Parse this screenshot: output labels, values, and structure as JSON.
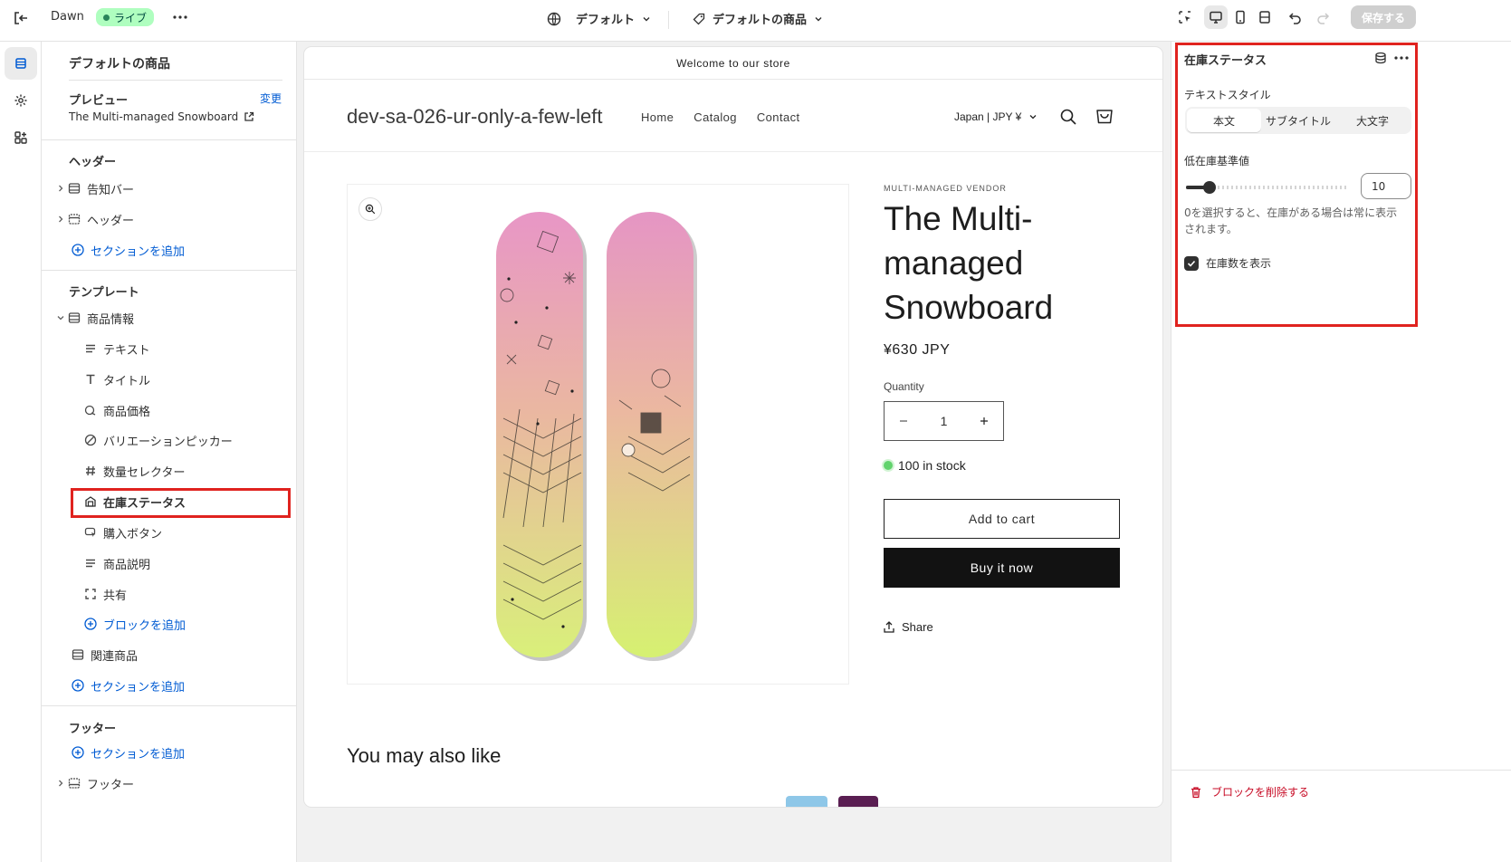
{
  "topbar": {
    "theme_name": "Dawn",
    "live_badge": "ライブ",
    "template_select": "デフォルト",
    "page_select": "デフォルトの商品",
    "save_label": "保存する"
  },
  "left_panel": {
    "title": "デフォルトの商品",
    "preview_label": "プレビュー",
    "preview_change": "変更",
    "preview_product": "The Multi-managed Snowboard",
    "header_section": {
      "heading": "ヘッダー",
      "items": [
        {
          "label": "告知バー",
          "icon": "announcement-bar-icon"
        },
        {
          "label": "ヘッダー",
          "icon": "header-layout-icon"
        }
      ],
      "add_section": "セクションを追加"
    },
    "template_section": {
      "heading": "テンプレート",
      "product_info": "商品情報",
      "blocks": [
        {
          "label": "テキスト",
          "icon": "text-lines-icon"
        },
        {
          "label": "タイトル",
          "icon": "title-t-icon"
        },
        {
          "label": "商品価格",
          "icon": "price-tag-icon"
        },
        {
          "label": "バリエーションピッカー",
          "icon": "variant-picker-icon"
        },
        {
          "label": "数量セレクター",
          "icon": "hashtag-icon"
        },
        {
          "label": "在庫ステータス",
          "icon": "inventory-icon"
        },
        {
          "label": "購入ボタン",
          "icon": "buy-button-icon"
        },
        {
          "label": "商品説明",
          "icon": "description-icon"
        },
        {
          "label": "共有",
          "icon": "share-frame-icon"
        }
      ],
      "add_block": "ブロックを追加",
      "related": "関連商品",
      "add_section": "セクションを追加"
    },
    "footer_section": {
      "heading": "フッター",
      "add_section": "セクションを追加",
      "footer_item": "フッター"
    }
  },
  "preview": {
    "announcement": "Welcome to our store",
    "store_name": "dev-sa-026-ur-only-a-few-left",
    "nav": [
      "Home",
      "Catalog",
      "Contact"
    ],
    "locale": "Japan | JPY ¥",
    "vendor": "MULTI-MANAGED VENDOR",
    "title_lines": [
      "The Multi-",
      "managed",
      "Snowboard"
    ],
    "price": "¥630 JPY",
    "quantity_label": "Quantity",
    "quantity": "1",
    "stock": "100 in stock",
    "add_to_cart": "Add to cart",
    "buy_now": "Buy it now",
    "share": "Share",
    "also_like": "You may also like"
  },
  "right_panel": {
    "title": "在庫ステータス",
    "text_style_label": "テキストスタイル",
    "text_style_options": [
      "本文",
      "サブタイトル",
      "大文字"
    ],
    "selected_style": "本文",
    "threshold_label": "低在庫基準値",
    "threshold_value": "10",
    "threshold_fraction": 0.1,
    "help_line1": "0を選択すると、在庫がある場合は常に表示",
    "help_line2": "されます。",
    "show_count_label": "在庫数を表示",
    "show_count_checked": true,
    "delete_block": "ブロックを削除する"
  },
  "colors": {
    "accent_blue": "#005bd3",
    "highlight_red": "#e0231f",
    "live_green": "#29845a",
    "stock_green": "#62d36d"
  }
}
